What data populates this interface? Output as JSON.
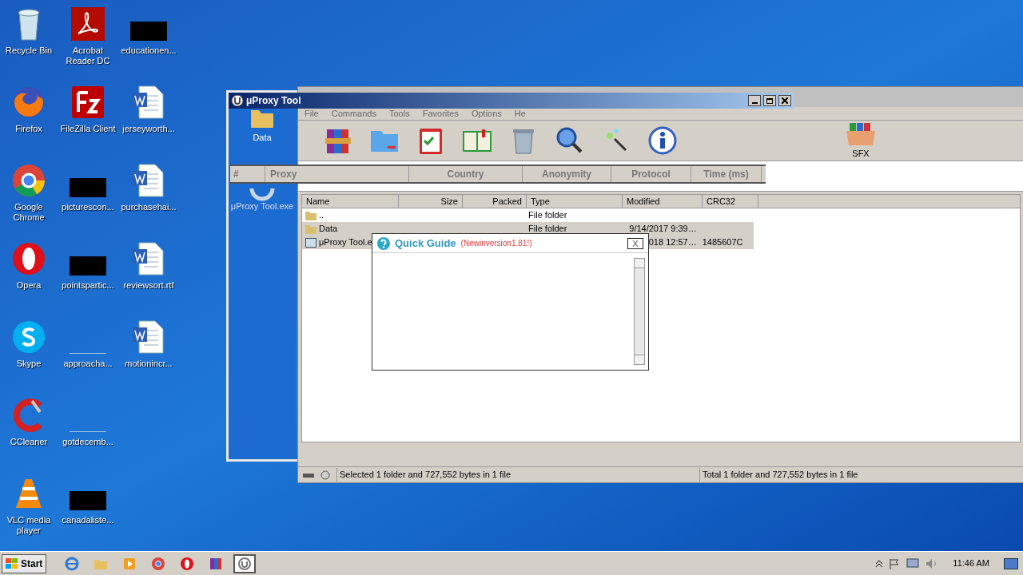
{
  "desktop_icons": [
    {
      "label": "Recycle Bin",
      "kind": "recycle"
    },
    {
      "label": "Acrobat Reader DC",
      "kind": "pdf"
    },
    {
      "label": "educationen...",
      "kind": "redacted"
    },
    {
      "label": "Firefox",
      "kind": "firefox"
    },
    {
      "label": "FileZilla Client",
      "kind": "filezilla"
    },
    {
      "label": "jerseyworth...",
      "kind": "word"
    },
    {
      "label": "Google Chrome",
      "kind": "chrome"
    },
    {
      "label": "picturescon...",
      "kind": "redacted"
    },
    {
      "label": "purchasehai...",
      "kind": "word"
    },
    {
      "label": "Opera",
      "kind": "opera"
    },
    {
      "label": "pointspartic...",
      "kind": "redacted"
    },
    {
      "label": "reviewsort.rtf",
      "kind": "word"
    },
    {
      "label": "Skype",
      "kind": "skype"
    },
    {
      "label": "approacha...",
      "kind": "blank"
    },
    {
      "label": "motionincr...",
      "kind": "word"
    },
    {
      "label": "CCleaner",
      "kind": "ccleaner"
    },
    {
      "label": "gotdecemb...",
      "kind": "blank"
    },
    {
      "kind": "none"
    },
    {
      "label": "VLC media player",
      "kind": "vlc"
    },
    {
      "label": "canadaliste...",
      "kind": "redacted"
    }
  ],
  "archiver": {
    "menu": [
      "File",
      "Commands",
      "Tools",
      "Favorites",
      "Options",
      "He"
    ],
    "toolbar": [
      {
        "kind": "archive"
      },
      {
        "kind": "folder"
      },
      {
        "kind": "clipboard"
      },
      {
        "kind": "book"
      },
      {
        "kind": "trash"
      },
      {
        "kind": "magnifier"
      },
      {
        "kind": "wand"
      },
      {
        "kind": "info"
      },
      {
        "kind": "sfx",
        "label": "SFX"
      }
    ],
    "columns": [
      "Name",
      "Size",
      "Packed",
      "Type",
      "Modified",
      "CRC32"
    ],
    "files": [
      {
        "kind": "up",
        "name": "..",
        "type": "File folder",
        "selected": false
      },
      {
        "kind": "folder",
        "name": "Data",
        "type": "File folder",
        "modified": "9/14/2017 9:39…",
        "selected": true
      },
      {
        "kind": "exe",
        "name": "μProxy Tool.e",
        "modified": "018 12:57…",
        "crc": "1485607C",
        "selected": true
      }
    ],
    "status_left": "Selected 1 folder and 727,552 bytes in 1 file",
    "status_right": "Total 1 folder and 727,552 bytes in 1 file"
  },
  "proxy_window": {
    "title": "μProxy Tool",
    "side_items": [
      {
        "label": "Data",
        "kind": "folder"
      },
      {
        "label": "μProxy Tool.exe",
        "kind": "app"
      }
    ],
    "columns": [
      "#",
      "Proxy",
      "Country",
      "Anonymity",
      "Protocol",
      "Time (ms)"
    ]
  },
  "quick_guide": {
    "title": "Quick Guide",
    "note": "(Newinversion1.81!)",
    "close": "X"
  },
  "taskbar": {
    "start": "Start",
    "apps": [
      {
        "kind": "ie",
        "selected": false
      },
      {
        "kind": "explorer",
        "selected": false
      },
      {
        "kind": "media",
        "selected": false
      },
      {
        "kind": "chrome",
        "selected": false
      },
      {
        "kind": "opera",
        "selected": false
      },
      {
        "kind": "archive",
        "selected": false
      },
      {
        "kind": "proxy",
        "selected": true
      }
    ],
    "time": "11:46 AM"
  }
}
